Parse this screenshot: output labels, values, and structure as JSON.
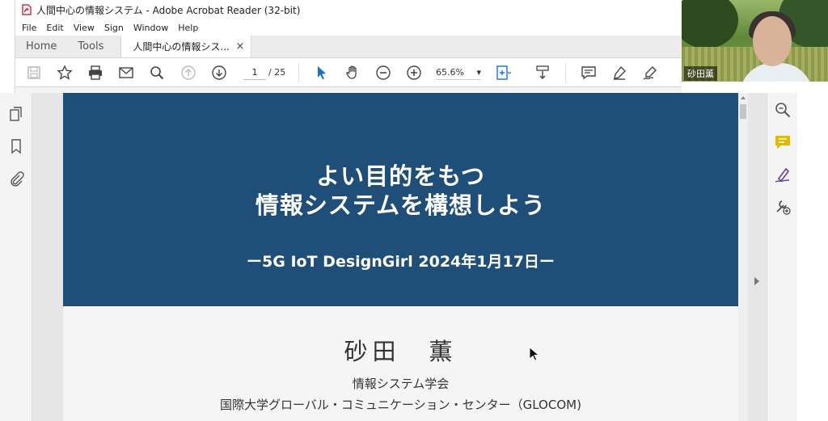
{
  "window": {
    "title": "人間中心の情報システム - Adobe Acrobat Reader (32-bit)"
  },
  "menu": [
    "File",
    "Edit",
    "View",
    "Sign",
    "Window",
    "Help"
  ],
  "tabs": {
    "home": "Home",
    "tools": "Tools",
    "document": "人間中心の情報シス...",
    "close": "×"
  },
  "toolbar": {
    "page_current": "1",
    "page_total": "/ 25",
    "zoom": "65.6%",
    "zoom_caret": "▾",
    "icons": [
      "save-icon",
      "star-icon",
      "print-icon",
      "email-icon",
      "search-icon",
      "page-up-icon",
      "page-down-icon",
      "select-cursor-icon",
      "hand-icon",
      "zoom-out-icon",
      "zoom-in-icon",
      "fit-page-icon",
      "scroll-mode-icon",
      "comment-icon",
      "highlight-icon",
      "sign-icon"
    ]
  },
  "slide": {
    "title_line1": "よい目的をもつ",
    "title_line2": "情報システムを構想しよう",
    "event": "ー5G IoT DesignGirl 2024年1月17日ー",
    "author": "砂田　薫",
    "affiliation1": "情報システム学会",
    "affiliation2": "国際大学グローバル・コミュニケーション・センター（GLOCOM)"
  },
  "webcam": {
    "participant_name": "砂田薫"
  },
  "colors": {
    "banner": "#1f4e79",
    "accent_blue": "#1a73c8",
    "comment_yellow": "#e6b800",
    "sign_purple": "#6b3fa0"
  }
}
